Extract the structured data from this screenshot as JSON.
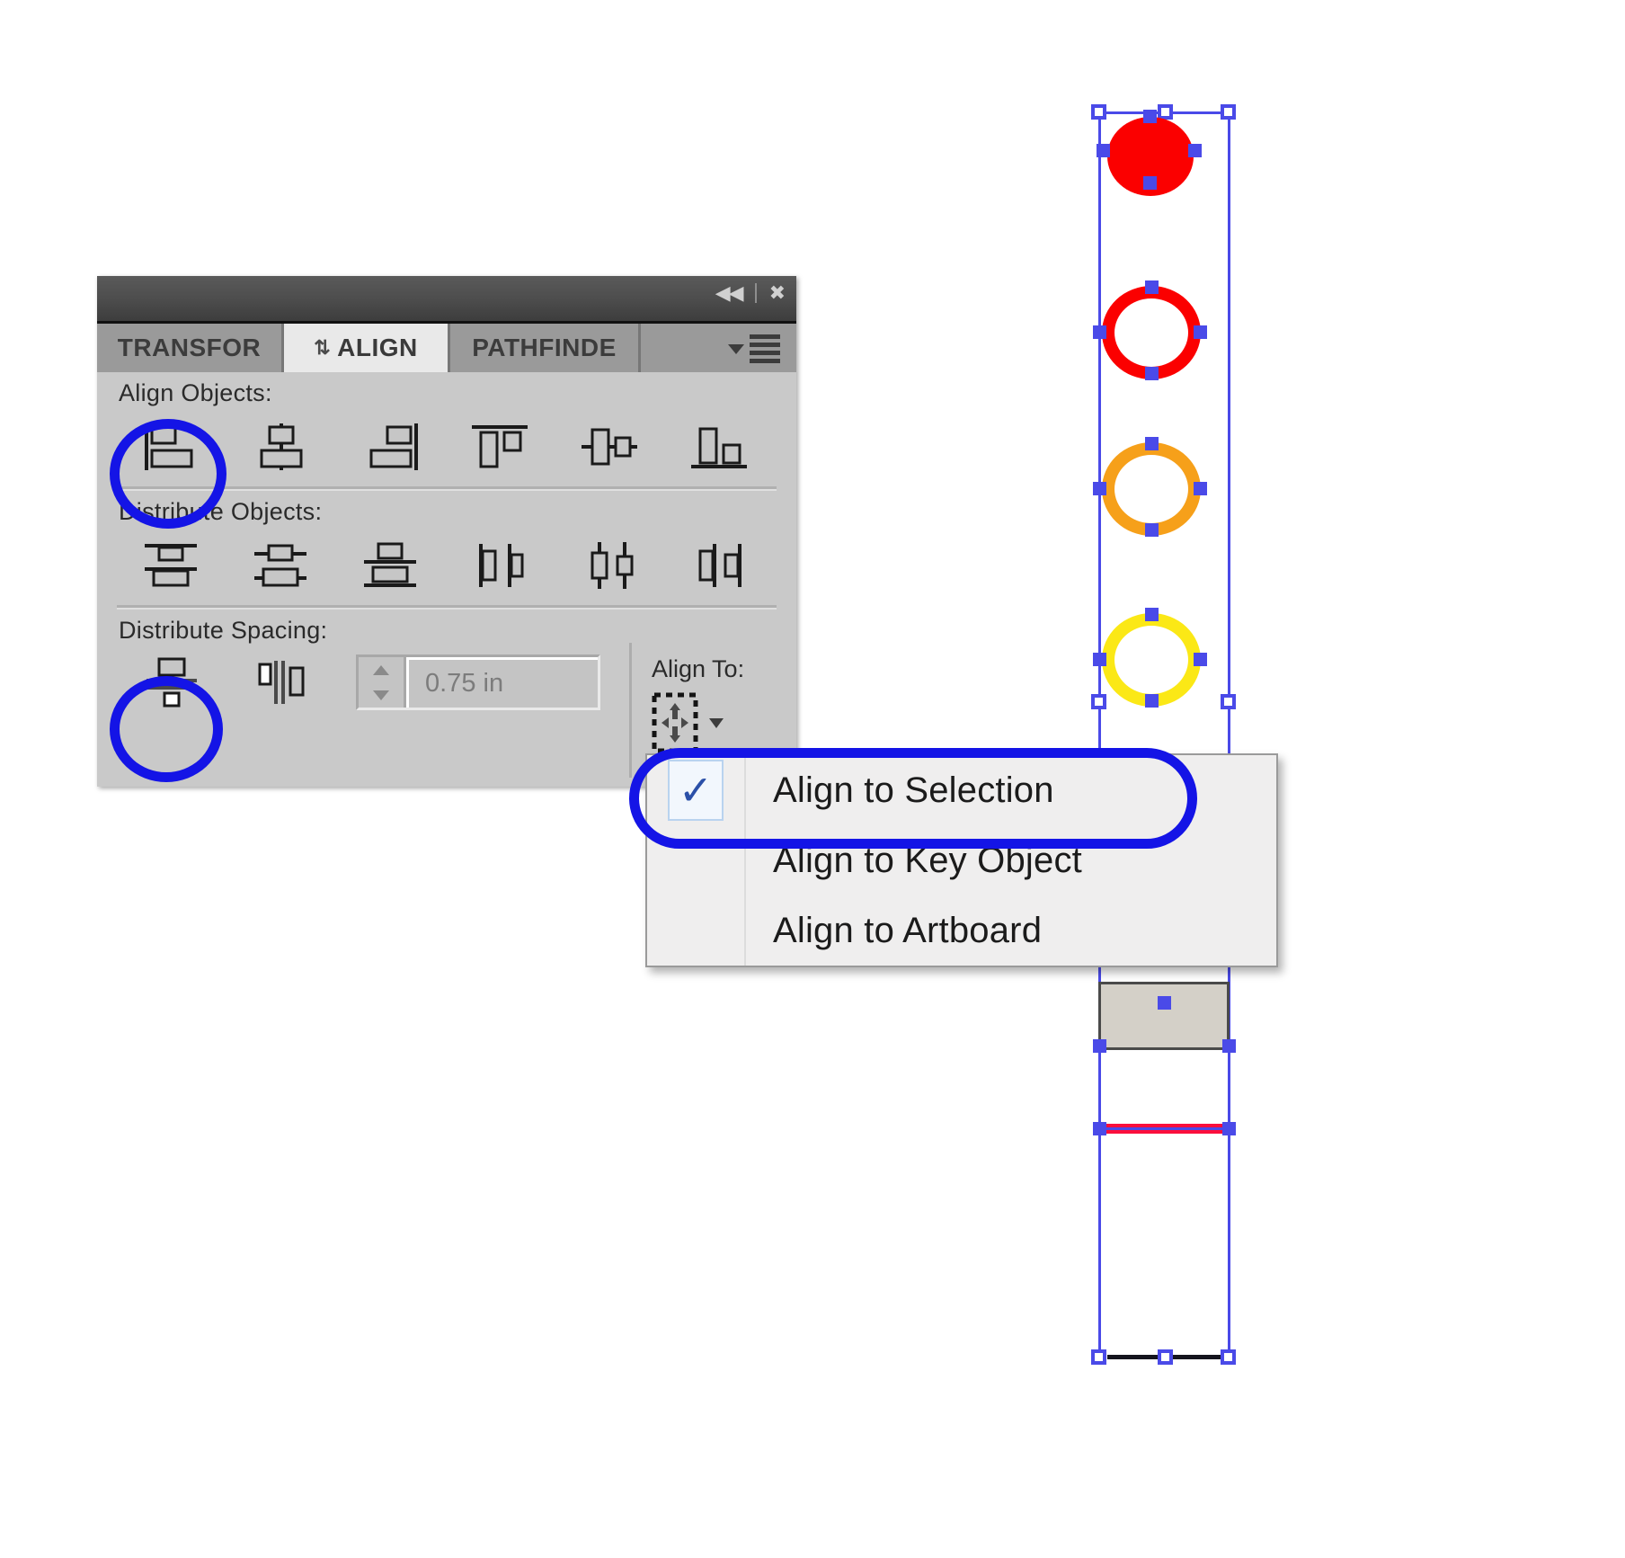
{
  "panel": {
    "titlebar": {
      "collapse_icon": "collapse-double-arrow-icon",
      "collapse_glyph": "◀◀",
      "close_icon": "close-icon",
      "close_glyph": "✖"
    },
    "tabs": [
      {
        "id": "transform",
        "label": "TRANSFOR",
        "active": false,
        "grip": ""
      },
      {
        "id": "align",
        "label": "ALIGN",
        "active": true,
        "grip": "⇅"
      },
      {
        "id": "pathfinder",
        "label": "PATHFINDE",
        "active": false,
        "grip": ""
      }
    ],
    "panel_menu_icon": "panel-menu-icon",
    "sections": {
      "align_objects": {
        "label": "Align Objects:",
        "buttons": [
          {
            "id": "horizontal-align-left",
            "name": "Horizontal Align Left"
          },
          {
            "id": "horizontal-align-center",
            "name": "Horizontal Align Center"
          },
          {
            "id": "horizontal-align-right",
            "name": "Horizontal Align Right"
          },
          {
            "id": "vertical-align-top",
            "name": "Vertical Align Top"
          },
          {
            "id": "vertical-align-center",
            "name": "Vertical Align Center"
          },
          {
            "id": "vertical-align-bottom",
            "name": "Vertical Align Bottom"
          }
        ]
      },
      "distribute_objects": {
        "label": "Distribute Objects:",
        "buttons": [
          {
            "id": "vertical-distribute-top",
            "name": "Vertical Distribute Top"
          },
          {
            "id": "vertical-distribute-center",
            "name": "Vertical Distribute Center"
          },
          {
            "id": "vertical-distribute-bottom",
            "name": "Vertical Distribute Bottom"
          },
          {
            "id": "horizontal-distribute-left",
            "name": "Horizontal Distribute Left"
          },
          {
            "id": "horizontal-distribute-center",
            "name": "Horizontal Distribute Center"
          },
          {
            "id": "horizontal-distribute-right",
            "name": "Horizontal Distribute Right"
          }
        ]
      },
      "distribute_spacing": {
        "label": "Distribute Spacing:",
        "buttons": [
          {
            "id": "vertical-distribute-spacing",
            "name": "Vertical Distribute Space"
          },
          {
            "id": "horizontal-distribute-spacing",
            "name": "Horizontal Distribute Space"
          }
        ],
        "value": "0.75 in",
        "spinner_up": "stepper-up-icon",
        "spinner_down": "stepper-down-icon"
      },
      "align_to": {
        "label": "Align To:",
        "icon": "align-to-selection-icon",
        "dropdown_icon": "chevron-down-icon"
      }
    }
  },
  "menu": {
    "items": [
      {
        "label": "Align to Selection",
        "checked": true,
        "check_glyph": "✓"
      },
      {
        "label": "Align to Key Object",
        "checked": false,
        "check_glyph": ""
      },
      {
        "label": "Align to Artboard",
        "checked": false,
        "check_glyph": ""
      }
    ]
  },
  "artwork": {
    "shapes": [
      {
        "id": "red-filled-circle",
        "kind": "circle-filled",
        "color": "#fb0000"
      },
      {
        "id": "red-ring",
        "kind": "circle-ring",
        "color": "#fb0000"
      },
      {
        "id": "orange-ring",
        "kind": "circle-ring",
        "color": "#f6a01a"
      },
      {
        "id": "yellow-ring",
        "kind": "circle-ring",
        "color": "#fbe816"
      },
      {
        "id": "gray-square",
        "kind": "square",
        "color": "#d4d0c8"
      },
      {
        "id": "red-bar",
        "kind": "line",
        "color": "#fb0e3c"
      },
      {
        "id": "black-line",
        "kind": "line",
        "color": "#14141e"
      }
    ],
    "selection_color": "#4a4ae8"
  },
  "annotations": {
    "accent_color": "#1414e6",
    "highlights": [
      {
        "id": "highlight-horizontal-align-left",
        "shape": "ellipse"
      },
      {
        "id": "highlight-vertical-distribute-spacing",
        "shape": "ellipse"
      },
      {
        "id": "highlight-align-to-selection",
        "shape": "rounded-rect"
      }
    ]
  }
}
